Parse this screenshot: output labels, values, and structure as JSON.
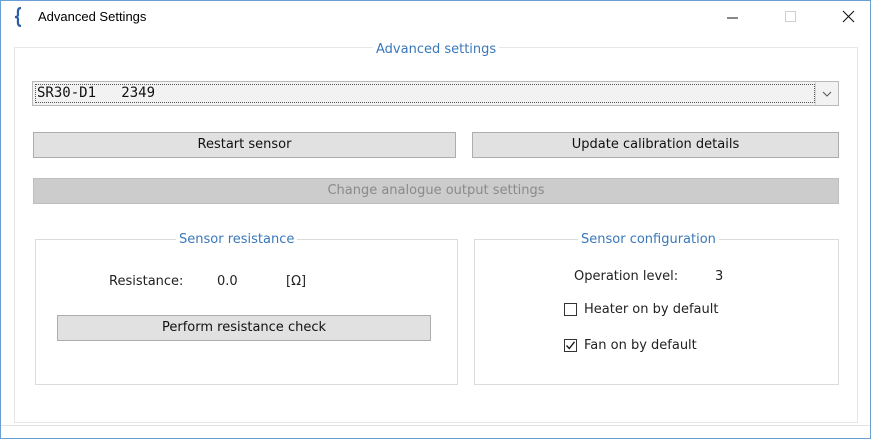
{
  "window": {
    "title": "Advanced Settings",
    "app_icon": "curly-brace-icon",
    "controls": [
      "minimize-icon",
      "maximize-icon",
      "close-icon"
    ]
  },
  "main_group": {
    "legend": "Advanced settings"
  },
  "sensor_select": {
    "selected": "SR30-D1   2349",
    "icon": "chevron-down-icon"
  },
  "buttons": {
    "restart": "Restart sensor",
    "update_calibration": "Update calibration details",
    "change_analogue": "Change analogue output settings"
  },
  "resistance_group": {
    "legend": "Sensor resistance",
    "resistance_label": "Resistance:",
    "resistance_value": "0.0",
    "resistance_unit": "[Ω]",
    "check_button": "Perform resistance check"
  },
  "config_group": {
    "legend": "Sensor configuration",
    "operation_label": "Operation level:",
    "operation_value": "3",
    "heater_label": "Heater on by default",
    "heater_checked": false,
    "fan_label": "Fan on by default",
    "fan_checked": true
  },
  "colors": {
    "legend_blue": "#3a78b9",
    "button_face": "#e1e1e1",
    "disabled_button": "#cccccc",
    "window_border": "#6a9fd4"
  }
}
